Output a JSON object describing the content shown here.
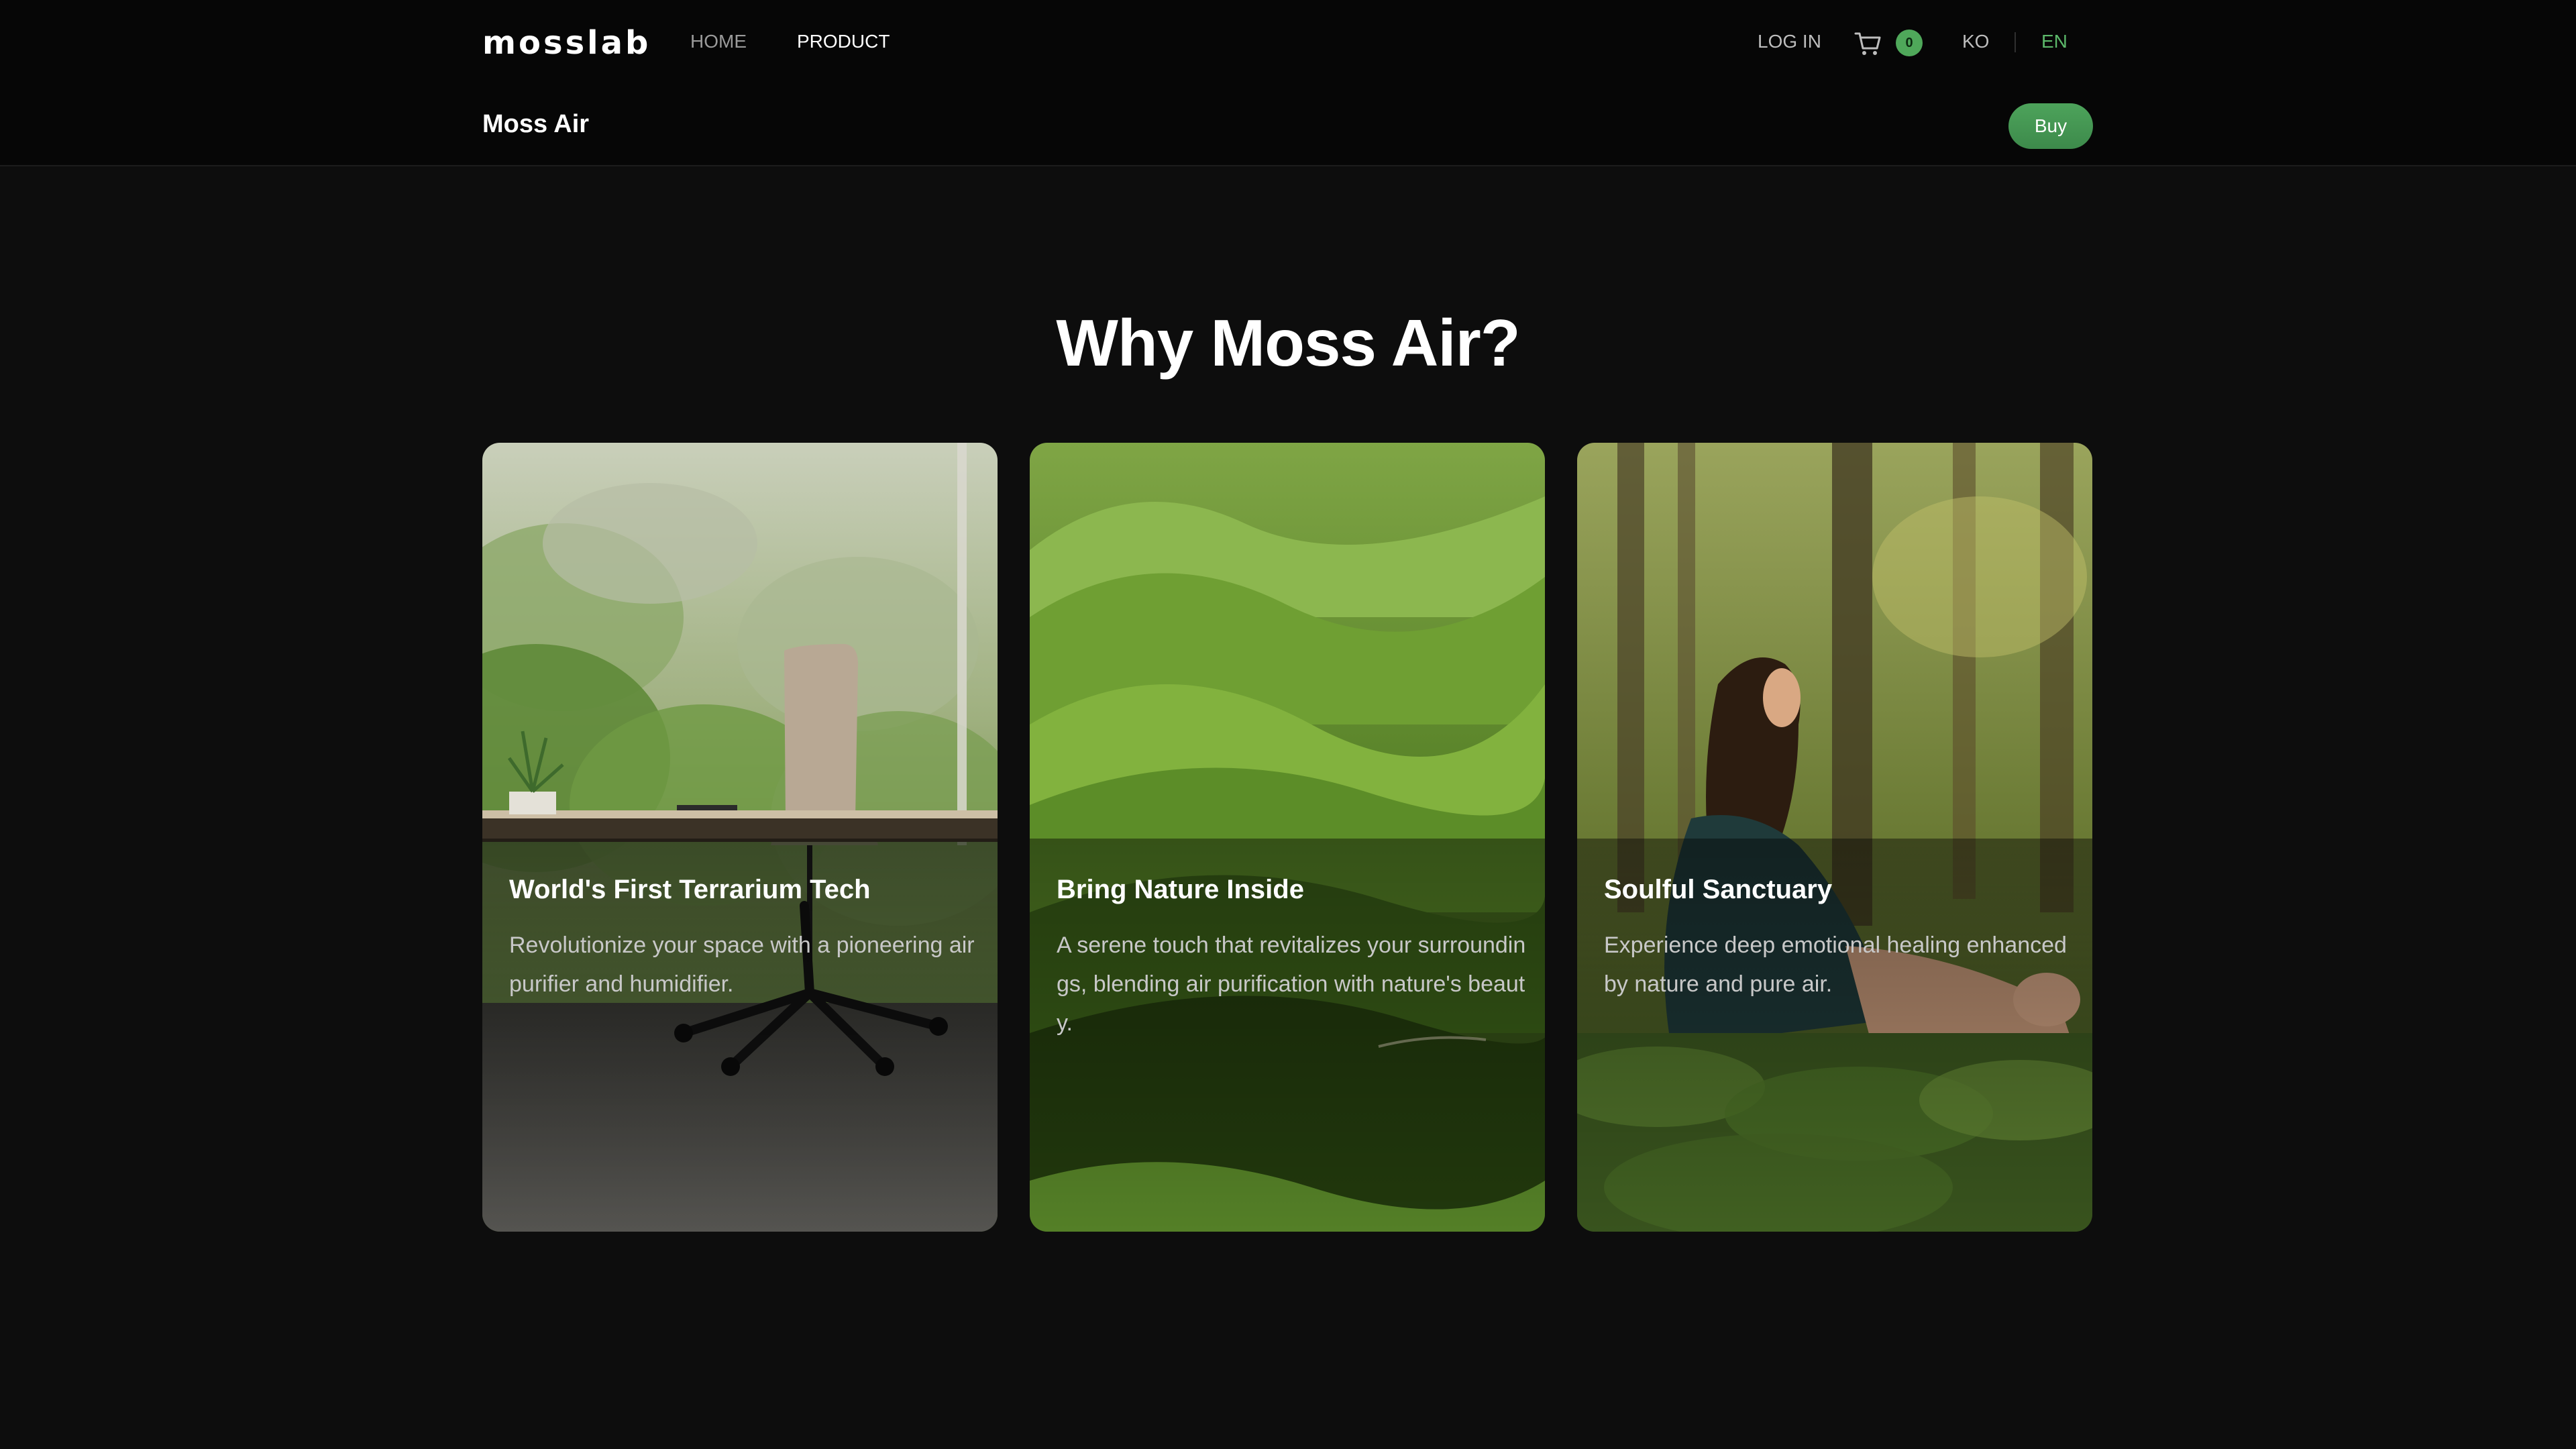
{
  "header": {
    "logo": "mosslab",
    "nav": [
      {
        "label": "HOME",
        "active": false
      },
      {
        "label": "PRODUCT",
        "active": true
      }
    ],
    "login_label": "LOG IN",
    "cart_icon": "cart-icon",
    "cart_count": "0",
    "languages": [
      {
        "label": "KO",
        "active": false
      },
      {
        "label": "EN",
        "active": true
      }
    ],
    "accent_color": "#5cb86a"
  },
  "subheader": {
    "product_name": "Moss Air",
    "buy_label": "Buy"
  },
  "main": {
    "section_title": "Why Moss Air?",
    "cards": [
      {
        "title": "World's First Terrarium Tech",
        "description": "Revolutionize your space with a pioneering air purifier and humidifier.",
        "image": "office-forest-view"
      },
      {
        "title": "Bring Nature Inside",
        "description": "A serene touch that revitalizes your surroundings, blending air purification with nature's beauty.",
        "image": "green-hills"
      },
      {
        "title": "Soulful Sanctuary",
        "description": "Experience deep emotional healing enhanced by nature and pure air.",
        "image": "woman-in-forest"
      }
    ]
  }
}
